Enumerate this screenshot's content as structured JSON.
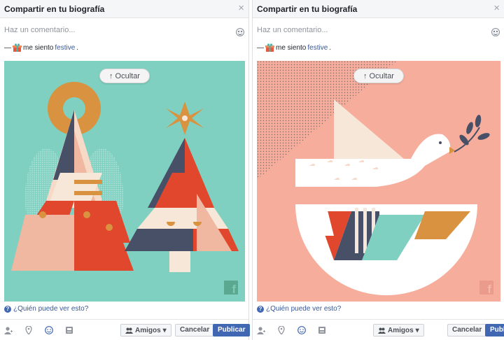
{
  "dialogs": [
    {
      "title": "Compartir en tu biografía",
      "close": "×",
      "comment_placeholder": "Haz un comentario...",
      "feeling_prefix": "—",
      "feeling_text": "me siento",
      "feeling_value": "festive",
      "feeling_suffix": ".",
      "hide_label": "Ocultar",
      "hide_arrow": "↑",
      "fb_letter": "f",
      "privacy_label": "¿Quién puede ver esto?",
      "privacy_icon": "?",
      "audience_label": "Amigos",
      "audience_caret": "▾",
      "cancel_label": "Cancelar",
      "publish_label": "Publicar",
      "image_bg": "#7fd0c0"
    },
    {
      "title": "Compartir en tu biografía",
      "close": "×",
      "comment_placeholder": "Haz un comentario...",
      "feeling_prefix": "—",
      "feeling_text": "me siento",
      "feeling_value": "festive",
      "feeling_suffix": ".",
      "hide_label": "Ocultar",
      "hide_arrow": "↑",
      "fb_letter": "f",
      "privacy_label": "¿Quién puede ver esto?",
      "privacy_icon": "?",
      "audience_label": "Amigos",
      "audience_caret": "▾",
      "cancel_label": "Cancelar",
      "publish_label": "Publicar",
      "image_bg": "#f7ad9c"
    }
  ],
  "colors": {
    "link": "#385898",
    "primary": "#4267b2",
    "header_bg": "#f5f6f7"
  },
  "footer_icons": [
    "tag-friends-icon",
    "location-pin-icon",
    "emoji-icon",
    "sticker-icon"
  ]
}
